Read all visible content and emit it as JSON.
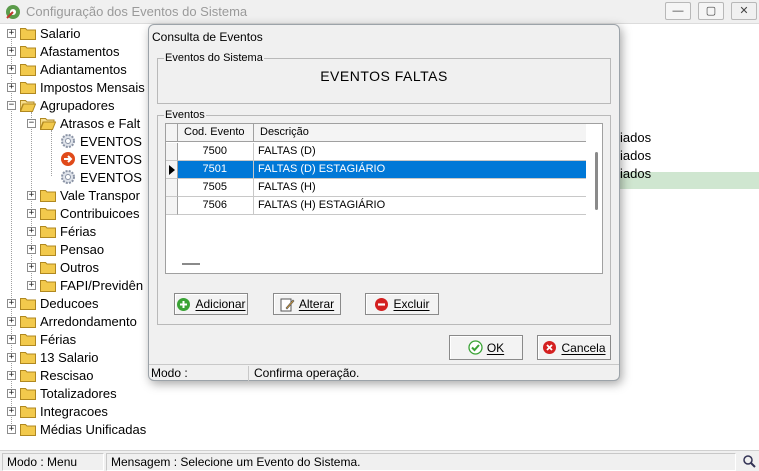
{
  "main_window": {
    "title": "Configuração dos Eventos do Sistema",
    "controls": {
      "minimize": "—",
      "maximize": "▢",
      "close": "✕"
    }
  },
  "tree": {
    "items": [
      {
        "label": "Salario",
        "expander": "+",
        "icon": "folder-icon"
      },
      {
        "label": "Afastamentos",
        "expander": "+",
        "icon": "folder-icon"
      },
      {
        "label": "Adiantamentos",
        "expander": "+",
        "icon": "folder-icon"
      },
      {
        "label": "Impostos Mensais",
        "expander": "+",
        "icon": "folder-icon"
      },
      {
        "label": "Agrupadores",
        "expander": "−",
        "icon": "open-folder-icon"
      },
      {
        "label": "Atrasos e Falt",
        "expander": "−",
        "icon": "open-folder-icon"
      },
      {
        "label": "EVENTOS",
        "icon": "gear-icon"
      },
      {
        "label": "EVENTOS",
        "icon": "red-arrow-icon"
      },
      {
        "label": "EVENTOS",
        "icon": "gear-icon"
      },
      {
        "label": "Vale Transpor",
        "expander": "+",
        "icon": "folder-icon"
      },
      {
        "label": "Contribuicoes",
        "expander": "+",
        "icon": "folder-icon"
      },
      {
        "label": "Férias",
        "expander": "+",
        "icon": "folder-icon"
      },
      {
        "label": "Pensao",
        "expander": "+",
        "icon": "folder-icon"
      },
      {
        "label": "Outros",
        "expander": "+",
        "icon": "folder-icon"
      },
      {
        "label": "FAPI/Previdên",
        "expander": "+",
        "icon": "folder-icon"
      },
      {
        "label": "Deducoes",
        "expander": "+",
        "icon": "folder-icon"
      },
      {
        "label": "Arredondamento",
        "expander": "+",
        "icon": "folder-icon"
      },
      {
        "label": "Férias",
        "expander": "+",
        "icon": "folder-icon"
      },
      {
        "label": "13 Salario",
        "expander": "+",
        "icon": "folder-icon"
      },
      {
        "label": "Rescisao",
        "expander": "+",
        "icon": "folder-icon"
      },
      {
        "label": "Totalizadores",
        "expander": "+",
        "icon": "folder-icon"
      },
      {
        "label": "Integracoes",
        "expander": "+",
        "icon": "folder-icon"
      },
      {
        "label": "Médias Unificadas",
        "expander": "+",
        "icon": "folder-icon"
      }
    ],
    "side_texts": [
      "iados",
      "iados",
      "iados"
    ]
  },
  "main_status": {
    "mode": "Modo : Menu",
    "message": "Mensagem : Selecione um Evento do Sistema."
  },
  "dialog": {
    "title": "Consulta de Eventos",
    "system_group_label": "Eventos do Sistema",
    "system_event_name": "EVENTOS FALTAS",
    "events_group_label": "Eventos",
    "grid": {
      "columns": [
        "Cod. Evento",
        "Descrição"
      ],
      "rows": [
        {
          "code": "7500",
          "description": "FALTAS (D)",
          "selected": false
        },
        {
          "code": "7501",
          "description": "FALTAS (D) ESTAGIÁRIO",
          "selected": true
        },
        {
          "code": "7505",
          "description": "FALTAS (H)",
          "selected": false
        },
        {
          "code": "7506",
          "description": "FALTAS (H) ESTAGIÁRIO",
          "selected": false
        }
      ]
    },
    "buttons": {
      "add": "Adicionar",
      "edit": "Alterar",
      "delete": "Excluir",
      "ok": "OK",
      "cancel": "Cancela"
    },
    "status": {
      "mode": "Modo :",
      "message": "Confirma operação."
    }
  },
  "colors": {
    "selection": "#0078d7",
    "tree_highlight": "#cfe6d0",
    "folder": "#f2c94c"
  }
}
